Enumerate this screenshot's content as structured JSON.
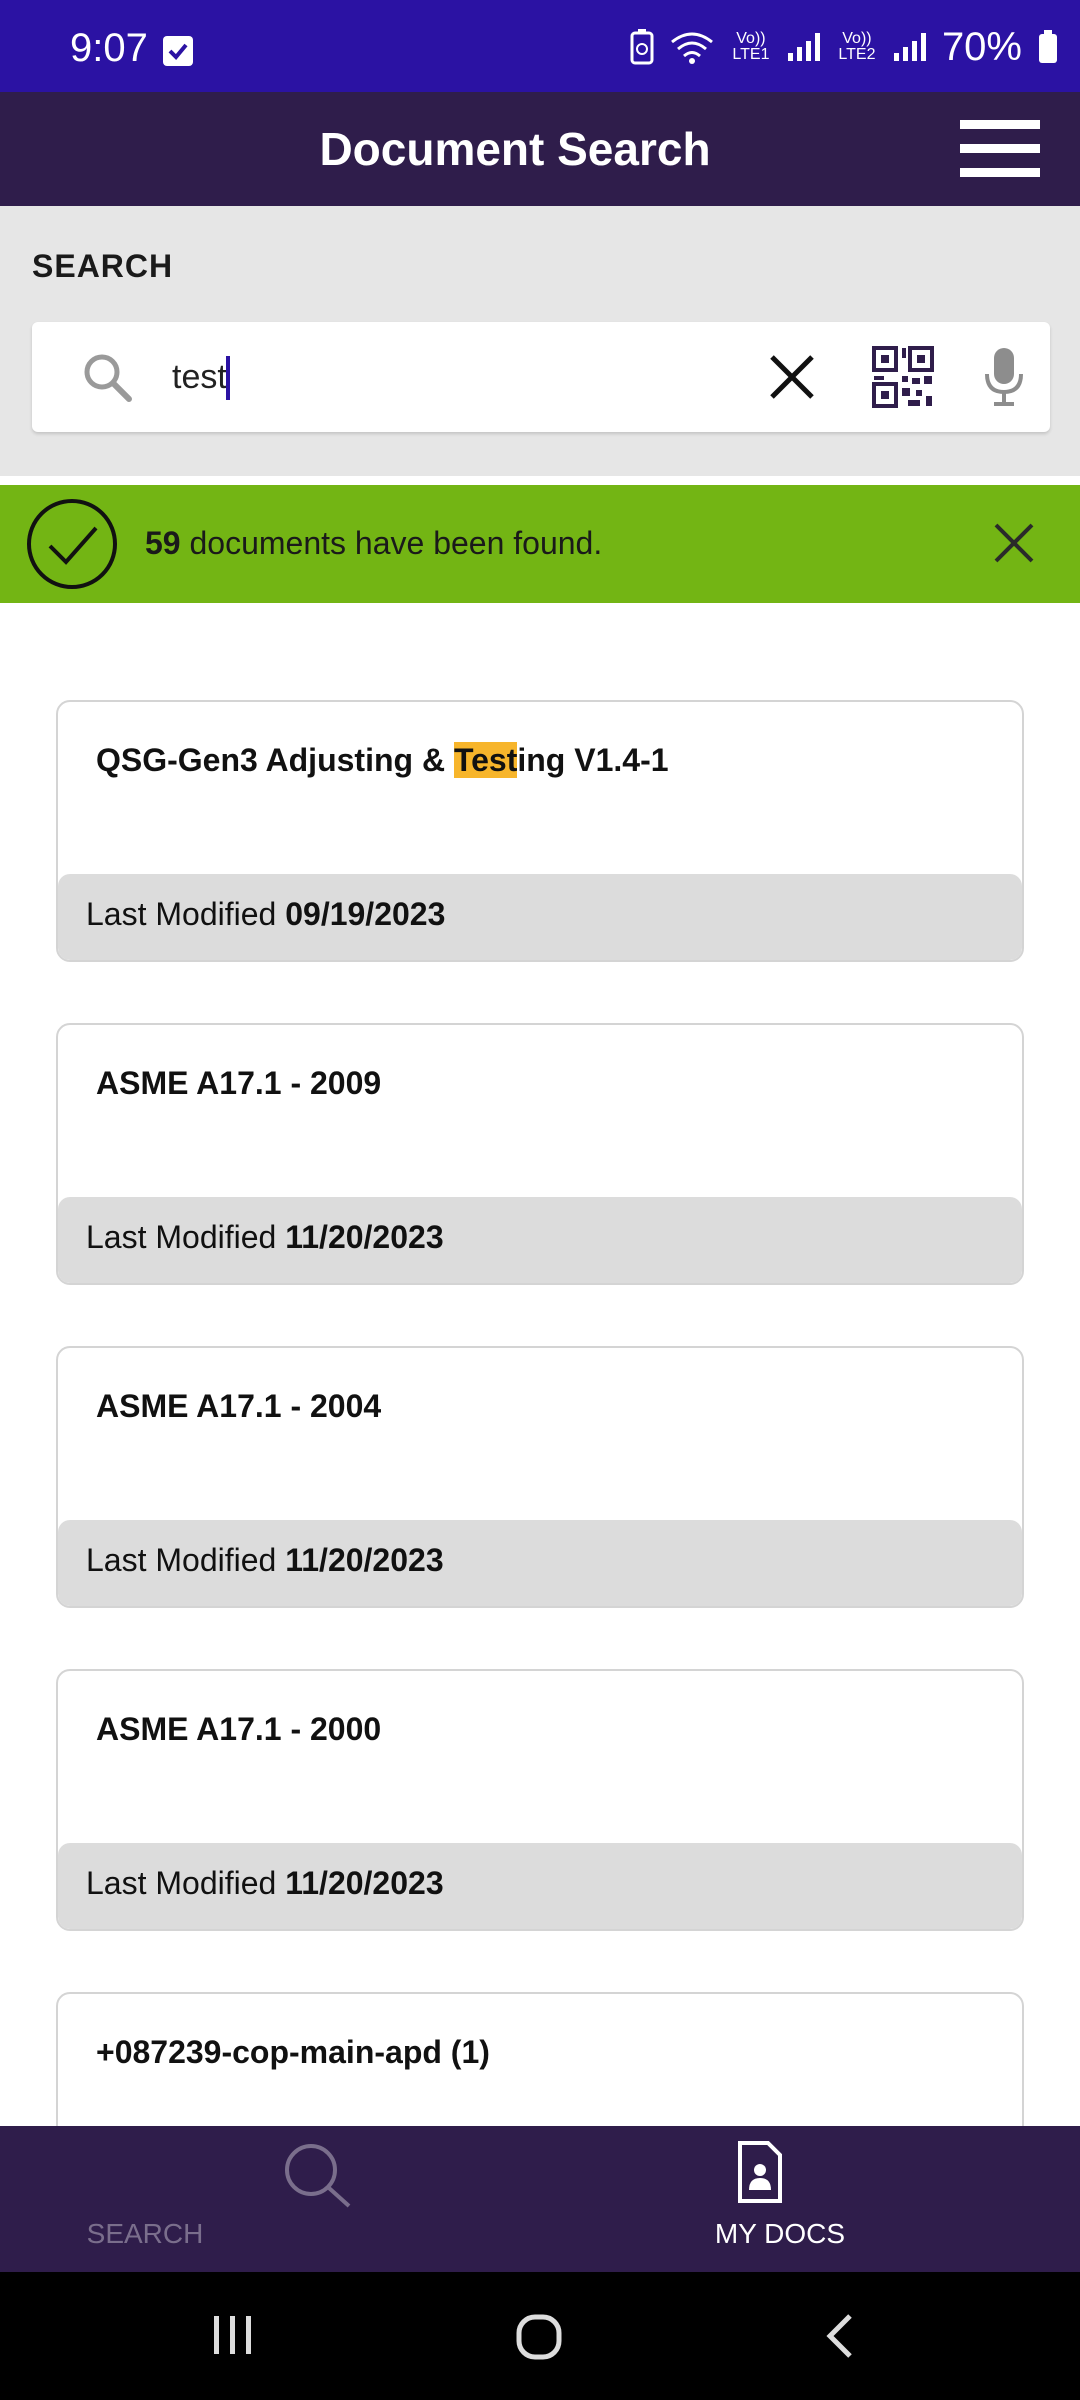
{
  "status_bar": {
    "time": "9:07",
    "sim1_label": "Vo)) LTE1",
    "sim2_label": "Vo)) LTE2",
    "battery": "70%"
  },
  "header": {
    "title": "Document Search"
  },
  "search": {
    "label": "SEARCH",
    "value": "test",
    "placeholder": ""
  },
  "banner": {
    "count": "59",
    "message": "documents have been found.",
    "color": "#73b514"
  },
  "results": [
    {
      "title_before": "QSG-Gen3 Adjusting & ",
      "title_highlight": "Test",
      "title_after": "ing V1.4-1",
      "modified_label": "Last Modified",
      "modified_date": "09/19/2023"
    },
    {
      "title_before": "ASME A17.1 - 2009",
      "title_highlight": "",
      "title_after": "",
      "modified_label": "Last Modified",
      "modified_date": "11/20/2023"
    },
    {
      "title_before": "ASME A17.1 - 2004",
      "title_highlight": "",
      "title_after": "",
      "modified_label": "Last Modified",
      "modified_date": "11/20/2023"
    },
    {
      "title_before": "ASME A17.1 - 2000",
      "title_highlight": "",
      "title_after": "",
      "modified_label": "Last Modified",
      "modified_date": "11/20/2023"
    },
    {
      "title_before": "+087239-cop-main-apd (1)",
      "title_highlight": "",
      "title_after": "",
      "modified_label": "",
      "modified_date": ""
    }
  ],
  "bottom_nav": {
    "search_label": "SEARCH",
    "mydocs_label": "MY DOCS"
  },
  "colors": {
    "status_bar": "#2b12a3",
    "header": "#2f1d4b",
    "highlight": "#f7b52b"
  },
  "icons": [
    "search-icon",
    "close-icon",
    "qr-code-icon",
    "microphone-icon",
    "check-circle-icon",
    "menu-icon",
    "document-icon",
    "recents-icon",
    "home-icon",
    "back-icon"
  ]
}
